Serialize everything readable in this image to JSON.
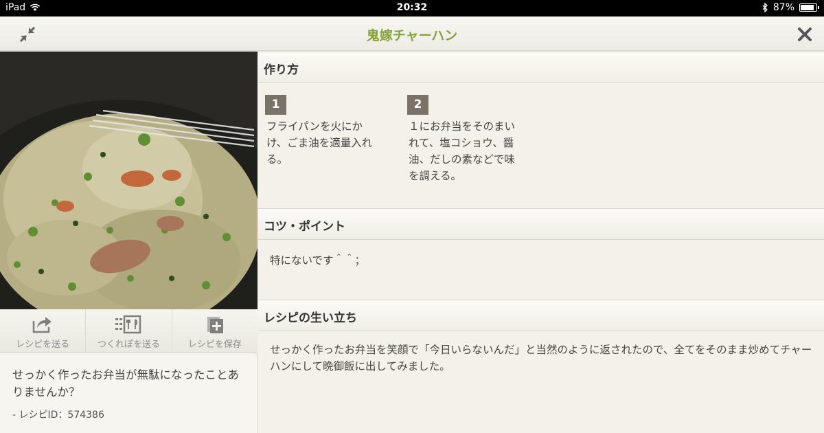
{
  "status_bar": {
    "device": "iPad",
    "time": "20:32",
    "battery": "87%",
    "battery_level": 0.87
  },
  "nav": {
    "title": "鬼嫁チャーハン"
  },
  "actions": [
    {
      "label": "レシピを送る",
      "icon": "share-icon"
    },
    {
      "label": "つくれぽを送る",
      "icon": "tsukurepo-icon"
    },
    {
      "label": "レシピを保存",
      "icon": "save-recipe-icon"
    }
  ],
  "intro": {
    "description": "せっかく作ったお弁当が無駄になったことありませんか？",
    "recipe_id": "- レシピID：574386"
  },
  "sections": {
    "steps_title": "作り方",
    "steps": [
      {
        "number": "1",
        "text": "フライパンを火にかけ、ごま油を適量入れる。"
      },
      {
        "number": "2",
        "text": "１にお弁当をそのまいれて、塩コショウ、醤油、だしの素などで味を調える。"
      }
    ],
    "tips_title": "コツ・ポイント",
    "tips_text": "特にないです＾＾；",
    "story_title": "レシピの生い立ち",
    "story_text": "せっかく作ったお弁当を笑顔で「今日いらないんだ」と当然のように返されたので、全てをそのまま炒めてチャーハンにして晩御飯に出してみました。"
  },
  "colors": {
    "title_green": "#8aa23a",
    "step_badge": "#7a7268"
  }
}
